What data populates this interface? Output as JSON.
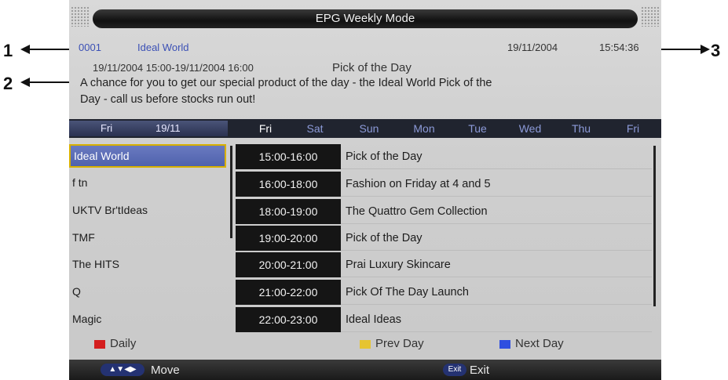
{
  "callouts": [
    "1",
    "2",
    "3"
  ],
  "epg": {
    "title": "EPG Weekly Mode",
    "channel_number": "0001",
    "channel_name": "Ideal World",
    "current_date": "19/11/2004",
    "current_time": "15:54:36",
    "program_time": "19/11/2004 15:00-19/11/2004 16:00",
    "program_title": "Pick of the Day",
    "program_description_line1": "A chance for you to get our special product of the day - the Ideal World Pick of the",
    "program_description_line2": "Day - call us before stocks run out!",
    "date_header": {
      "day": "Fri",
      "date": "19/11"
    },
    "weekdays": [
      "Fri",
      "Sat",
      "Sun",
      "Mon",
      "Tue",
      "Wed",
      "Thu",
      "Fri"
    ],
    "selected_weekday_index": 0,
    "channels": [
      "Ideal World",
      "f tn",
      "UKTV Br'tIdeas",
      "TMF",
      "The HITS",
      "Q",
      "Magic"
    ],
    "selected_channel_index": 0,
    "programs": [
      {
        "time": "15:00-16:00",
        "title": "Pick of the Day"
      },
      {
        "time": "16:00-18:00",
        "title": "Fashion on Friday at 4 and 5"
      },
      {
        "time": "18:00-19:00",
        "title": "The Quattro Gem Collection"
      },
      {
        "time": "19:00-20:00",
        "title": "Pick of the Day"
      },
      {
        "time": "20:00-21:00",
        "title": "Prai Luxury Skincare"
      },
      {
        "time": "21:00-22:00",
        "title": "Pick Of The Day Launch"
      },
      {
        "time": "22:00-23:00",
        "title": "Ideal Ideas"
      }
    ],
    "legend": [
      {
        "label": "Daily",
        "color": "#d41e1e"
      },
      {
        "label": "Prev Day",
        "color": "#e6c431"
      },
      {
        "label": "Next Day",
        "color": "#2f4fe0"
      }
    ],
    "bottom": {
      "move_pill": "▲▼◀▶",
      "move_label": "Move",
      "exit_pill": "Exit",
      "exit_label": "Exit"
    }
  }
}
